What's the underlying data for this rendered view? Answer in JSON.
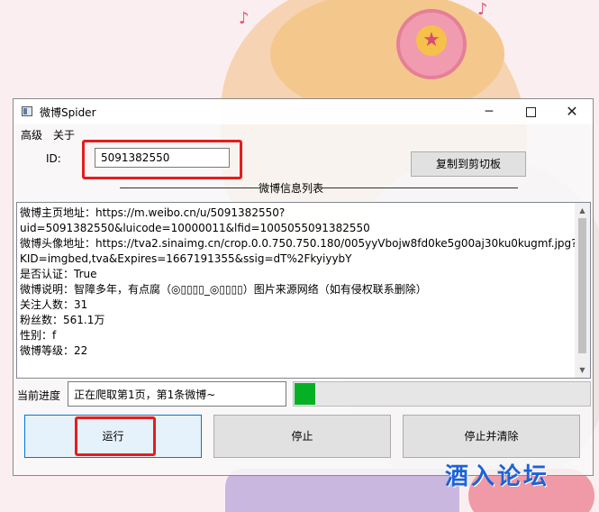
{
  "window": {
    "title": "微博Spider",
    "controls": {
      "minimize": "─",
      "close": "✕"
    }
  },
  "menu": [
    "高级",
    "关于"
  ],
  "id_field": {
    "label": "ID:",
    "value": "5091382550"
  },
  "copy_button": "复制到剪切板",
  "group_title": "微博信息列表",
  "info_lines": [
    "微博主页地址：https://m.weibo.cn/u/5091382550?",
    "uid=5091382550&luicode=10000011&lfid=1005055091382550",
    "微博头像地址：https://tva2.sinaimg.cn/crop.0.0.750.750.180/005yyVbojw8fd0ke5g00aj30ku0kugmf.jpg?",
    "KID=imgbed,tva&Expires=1667191355&ssig=dT%2FkyiyybY",
    "是否认证：True",
    "微博说明：智障多年，有点腐（◎▯▯▯▯_◎▯▯▯▯）图片来源网络（如有侵权联系删除）",
    "关注人数：31",
    "粉丝数：561.1万",
    "性别：f",
    "微博等级：22"
  ],
  "progress": {
    "label": "当前进度",
    "status": "正在爬取第1页，第1条微博~",
    "percent": 7
  },
  "buttons": {
    "run": "运行",
    "stop": "停止",
    "stop_clear": "停止并清除"
  },
  "watermark": "酒入论坛",
  "colors": {
    "highlight_red": "#e51d1d",
    "progress_green": "#06b025",
    "watermark_blue": "#1b63d8"
  }
}
